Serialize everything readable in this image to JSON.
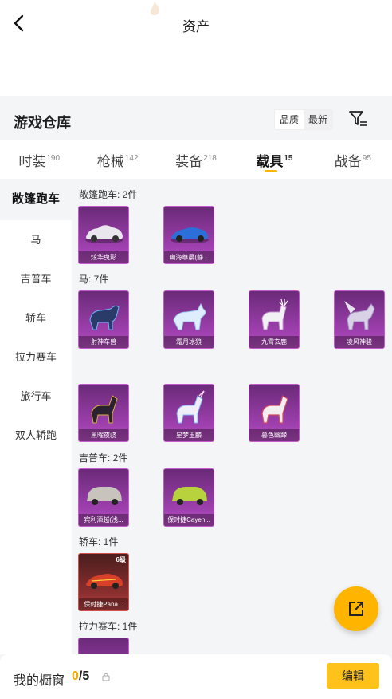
{
  "header": {
    "title": "资产"
  },
  "warehouse": {
    "title": "游戏仓库",
    "sort_options": [
      "品质",
      "最新"
    ],
    "active_sort": "最新"
  },
  "tabs": [
    {
      "label": "时装",
      "count": "190"
    },
    {
      "label": "枪械",
      "count": "142"
    },
    {
      "label": "装备",
      "count": "218"
    },
    {
      "label": "载具",
      "count": "15"
    },
    {
      "label": "战备",
      "count": "95"
    }
  ],
  "sidebar": {
    "items": [
      "敞篷跑车",
      "马",
      "吉普车",
      "轿车",
      "拉力赛车",
      "旅行车",
      "双人轿跑"
    ]
  },
  "groups": [
    {
      "label": "敞篷跑车: 2件",
      "items": [
        {
          "name": "炫华曳影",
          "art": "car-white"
        },
        {
          "name": "幽海尊晨(静...",
          "art": "car-blue"
        }
      ]
    },
    {
      "label": "马: 7件",
      "items": [
        {
          "name": "射神车兽",
          "art": "beast-blue"
        },
        {
          "name": "霜月冰狼",
          "art": "wolf-ice"
        },
        {
          "name": "九霄玄鹿",
          "art": "deer-white"
        },
        {
          "name": "凌风神骏",
          "art": "pegasus"
        },
        {
          "name": "黑曜夜骁",
          "art": "horse-black"
        },
        {
          "name": "星梦玉麟",
          "art": "unicorn"
        },
        {
          "name": "暮色幽蹄",
          "art": "horse-red"
        }
      ]
    },
    {
      "label": "吉普车: 2件",
      "items": [
        {
          "name": "宾利添越(浅...",
          "art": "suv-silver"
        },
        {
          "name": "保时捷Cayen...",
          "art": "suv-lime"
        }
      ]
    },
    {
      "label": "轿车: 1件",
      "items": [
        {
          "name": "保时捷Pana...",
          "art": "sedan-red",
          "level": "6级"
        }
      ]
    },
    {
      "label": "拉力赛车: 1件",
      "items": []
    }
  ],
  "footer": {
    "label": "我的橱窗",
    "current": "0",
    "total": "/5",
    "edit_label": "编辑"
  },
  "colors": {
    "accent": "#ffb400",
    "card_purple": "#9e3fae",
    "card_red": "#8c2f2f"
  }
}
